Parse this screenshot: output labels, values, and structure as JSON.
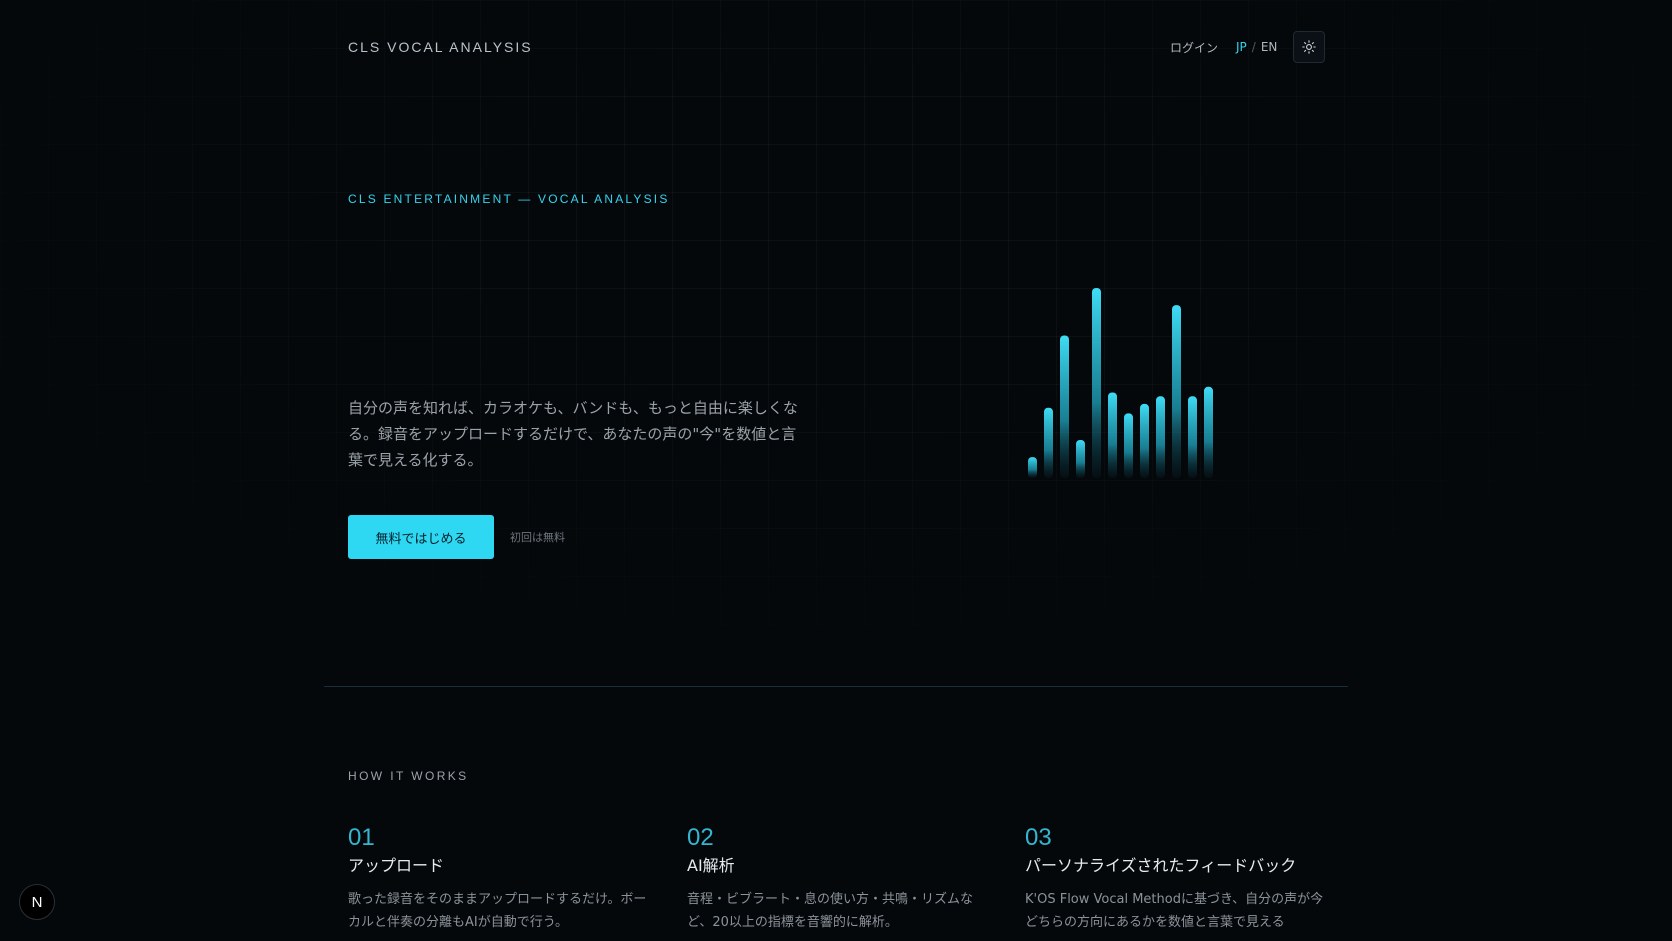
{
  "header": {
    "brand": "CLS VOCAL ANALYSIS",
    "login": "ログイン",
    "lang_jp": "JP",
    "lang_sep": "/",
    "lang_en": "EN",
    "theme_icon": "sun-icon"
  },
  "hero": {
    "eyebrow": "CLS ENTERTAINMENT — VOCAL ANALYSIS",
    "lede": "自分の声を知れば、カラオケも、バンドも、もっと自由に楽しくなる。録音をアップロードするだけで、あなたの声の\"今\"を数値と言葉で見える化する。",
    "cta": "無料ではじめる",
    "cta_note": "初回は無料",
    "bars": {
      "levels": [
        0.11,
        0.37,
        0.75,
        0.2,
        1.0,
        0.45,
        0.34,
        0.39,
        0.43,
        0.91,
        0.43,
        0.48
      ],
      "accent": "#35d3ee"
    }
  },
  "how": {
    "label": "HOW IT WORKS",
    "steps": [
      {
        "num": "01",
        "title": "アップロード",
        "desc": "歌った録音をそのままアップロードするだけ。ボーカルと伴奏の分離もAIが自動で行う。"
      },
      {
        "num": "02",
        "title": "AI解析",
        "desc": "音程・ビブラート・息の使い方・共鳴・リズムなど、20以上の指標を音響的に解析。"
      },
      {
        "num": "03",
        "title": "パーソナライズされたフィードバック",
        "desc": "K'OS Flow Vocal Methodに基づき、自分の声が今どちらの方向にあるかを数値と言葉で見える"
      }
    ]
  },
  "badge": "N"
}
